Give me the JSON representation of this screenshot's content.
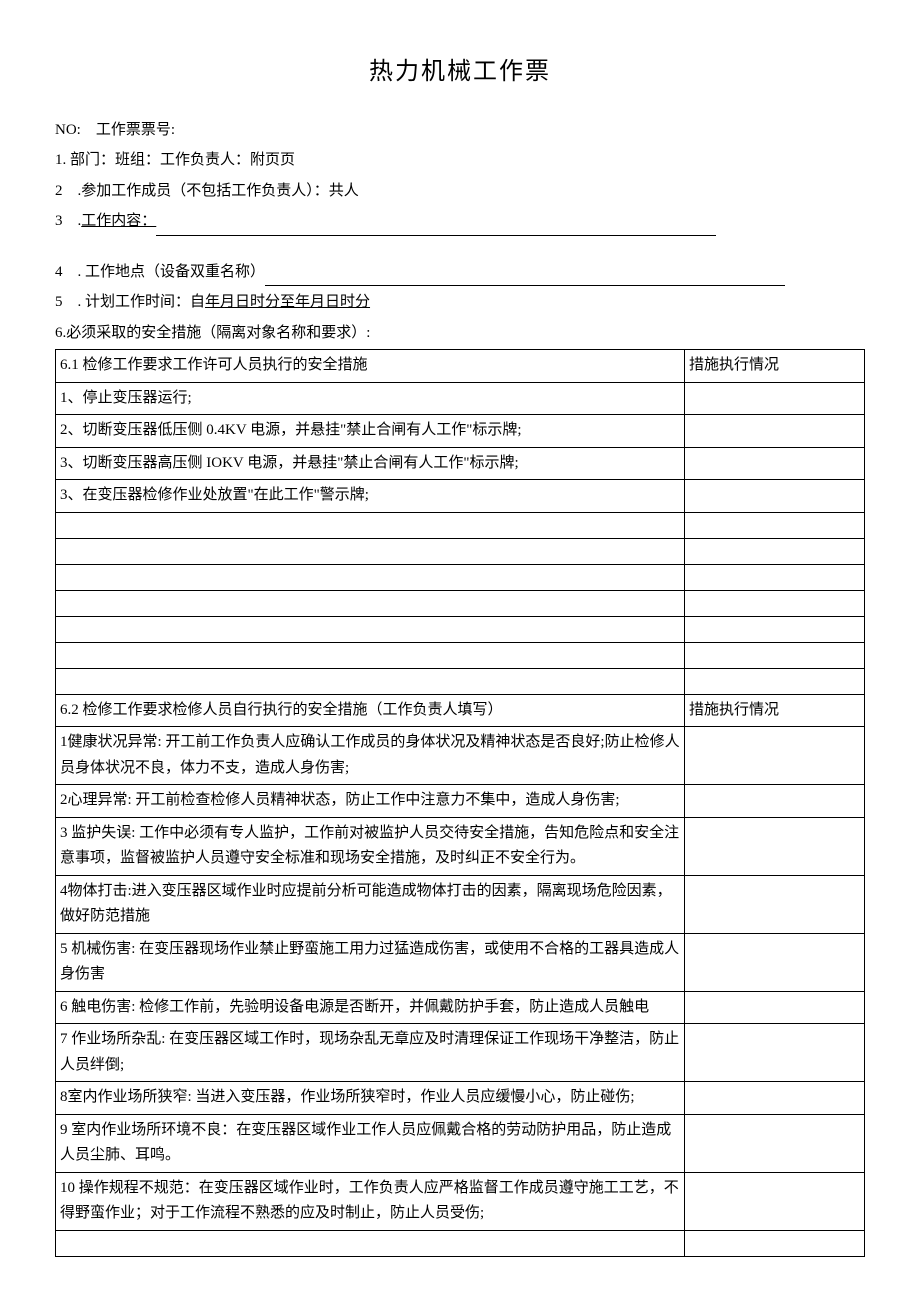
{
  "title": "热力机械工作票",
  "header": {
    "no_label": "NO: 工作票票号:",
    "line1": "1. 部门：班组：工作负责人：附页页",
    "line2": "2 .参加工作成员（不包括工作负责人）：共人",
    "line3_prefix": "3 .",
    "line3_label": "工作内容：",
    "line4_prefix": "4 . 工作地点（设备双重名称）",
    "line5_prefix": "5 . 计划工作时间：自",
    "line5_u": "年月日时分至年月日时分",
    "line6": "6.必须采取的安全措施（隔离对象名称和要求）:"
  },
  "table61": {
    "header_left": "6.1 检修工作要求工作许可人员执行的安全措施",
    "header_right": "措施执行情况",
    "rows": [
      "1、停止变压器运行;",
      "2、切断变压器低压侧 0.4KV 电源，并悬挂\"禁止合闸有人工作\"标示牌;",
      "3、切断变压器高压侧 IOKV 电源，并悬挂\"禁止合闸有人工作\"标示牌;",
      "3、在变压器检修作业处放置\"在此工作\"警示牌;",
      "",
      "",
      "",
      "",
      "",
      "",
      ""
    ]
  },
  "table62": {
    "header_left": "6.2 检修工作要求检修人员自行执行的安全措施（工作负责人填写）",
    "header_right": "措施执行情况",
    "rows": [
      "1健康状况异常: 开工前工作负责人应确认工作成员的身体状况及精神状态是否良好;防止检修人员身体状况不良，体力不支，造成人身伤害;",
      "2心理异常: 开工前检查检修人员精神状态，防止工作中注意力不集中，造成人身伤害;",
      "3 监护失误: 工作中必须有专人监护，工作前对被监护人员交待安全措施，告知危险点和安全注意事项，监督被监护人员遵守安全标准和现场安全措施，及时纠正不安全行为。",
      "4物体打击:进入变压器区域作业时应提前分析可能造成物体打击的因素，隔离现场危险因素，做好防范措施",
      "5 机械伤害: 在变压器现场作业禁止野蛮施工用力过猛造成伤害，或使用不合格的工器具造成人身伤害",
      "6 触电伤害: 检修工作前，先验明设备电源是否断开，并佩戴防护手套，防止造成人员触电",
      "7 作业场所杂乱: 在变压器区域工作时，现场杂乱无章应及时清理保证工作现场干净整洁，防止人员绊倒;",
      "8室内作业场所狭窄: 当进入变压器，作业场所狭窄时，作业人员应缓慢小心，防止碰伤;",
      "9 室内作业场所环境不良：在变压器区域作业工作人员应佩戴合格的劳动防护用品，防止造成人员尘肺、耳鸣。",
      "10 操作规程不规范：在变压器区域作业时，工作负责人应严格监督工作成员遵守施工工艺，不得野蛮作业；对于工作流程不熟悉的应及时制止，防止人员受伤;",
      ""
    ]
  }
}
